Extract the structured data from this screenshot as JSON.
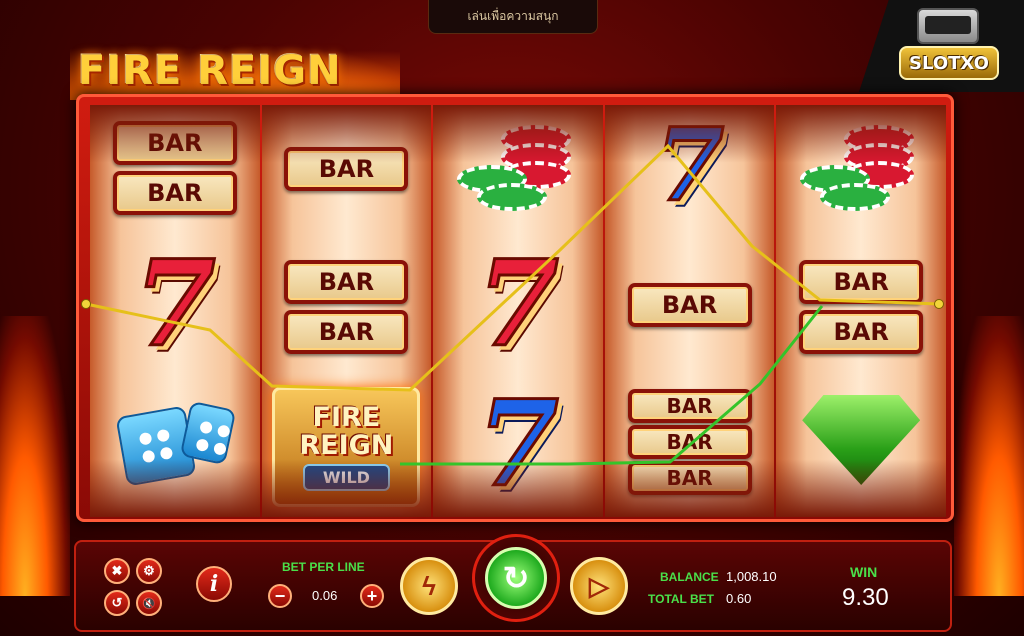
{
  "top_banner": {
    "text": "เล่นเพื่อความสนุก"
  },
  "game_logo": {
    "text": "FIRE REIGN"
  },
  "brand_logo": {
    "text": "SLOTXO"
  },
  "reels": [
    {
      "symbols": [
        "BAR",
        "BAR",
        "7",
        "dice"
      ]
    },
    {
      "symbols": [
        "BAR",
        "BAR",
        "BAR",
        "wild"
      ]
    },
    {
      "symbols": [
        "chips",
        "7",
        "7"
      ]
    },
    {
      "symbols": [
        "7",
        "BAR",
        "BAR",
        "BAR",
        "BAR"
      ]
    },
    {
      "symbols": [
        "chips",
        "BAR",
        "BAR",
        "diamond"
      ]
    }
  ],
  "symbols": {
    "bar_label": "BAR",
    "seven_label": "7",
    "wild_line1": "FIRE",
    "wild_line2": "REIGN",
    "wild_badge": "WILD"
  },
  "colors": {
    "payline_yellow": "#e6c01a",
    "payline_green": "#34c42a",
    "seven_red": "#e8203a",
    "seven_blue": "#1e63e8"
  },
  "controls": {
    "close_icon": "✖",
    "settings_icon": "⚙",
    "history_icon": "↺",
    "mute_icon": "🔇",
    "info_label": "i",
    "bet_per_line_label": "BET PER LINE",
    "bet_per_line_value": "0.06",
    "minus_label": "−",
    "plus_label": "+",
    "turbo_icon": "ϟ",
    "spin_icon": "↻",
    "autoplay_icon": "▷",
    "balance_label": "BALANCE",
    "balance_value": "1,008.10",
    "total_bet_label": "TOTAL BET",
    "total_bet_value": "0.60",
    "win_label": "WIN",
    "win_value": "9.30"
  }
}
